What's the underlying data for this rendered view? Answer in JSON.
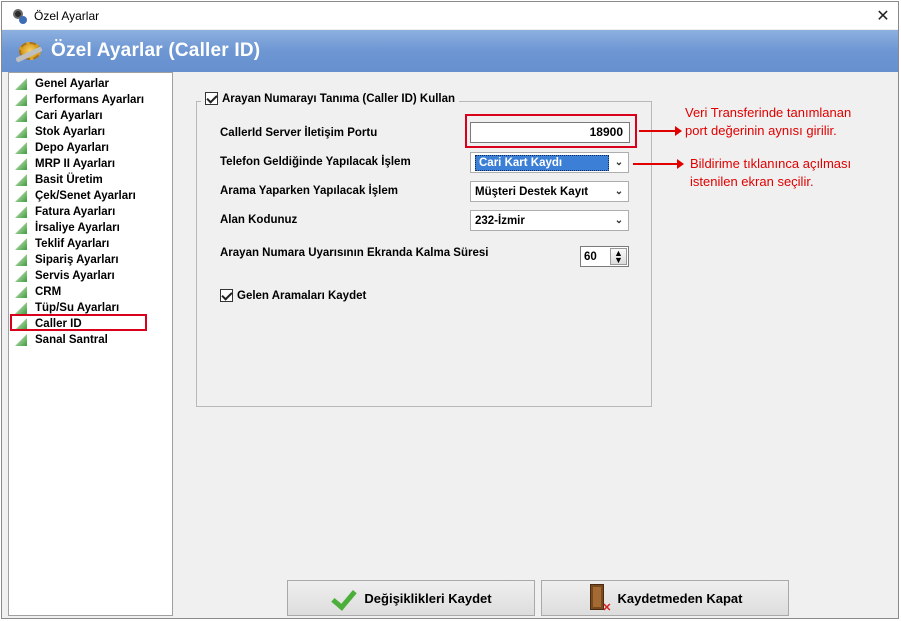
{
  "window": {
    "title": "Özel Ayarlar",
    "header_title": "Özel Ayarlar (Caller ID)"
  },
  "sidebar": {
    "items": [
      {
        "label": "Genel Ayarlar"
      },
      {
        "label": "Performans Ayarları"
      },
      {
        "label": "Cari Ayarları"
      },
      {
        "label": "Stok Ayarları"
      },
      {
        "label": "Depo Ayarları"
      },
      {
        "label": "MRP II Ayarları"
      },
      {
        "label": "Basit Üretim"
      },
      {
        "label": "Çek/Senet Ayarları"
      },
      {
        "label": "Fatura Ayarları"
      },
      {
        "label": "İrsaliye Ayarları"
      },
      {
        "label": "Teklif Ayarları"
      },
      {
        "label": "Sipariş Ayarları"
      },
      {
        "label": "Servis Ayarları"
      },
      {
        "label": "CRM"
      },
      {
        "label": "Tüp/Su Ayarları"
      },
      {
        "label": "Caller ID"
      },
      {
        "label": "Sanal Santral"
      }
    ],
    "selected": "Caller ID"
  },
  "form": {
    "group_label": "Arayan Numarayı Tanıma (Caller ID) Kullan",
    "group_checked": true,
    "port_label": "CallerId Server İletişim Portu",
    "port_value": "18900",
    "incoming_call_label": "Telefon Geldiğinde Yapılacak İşlem",
    "incoming_call_value": "Cari Kart Kaydı",
    "outgoing_call_label": "Arama Yaparken Yapılacak İşlem",
    "outgoing_call_value": "Müşteri Destek Kayıt",
    "area_code_label": "Alan Kodunuz",
    "area_code_value": "232-İzmir",
    "duration_label": "Arayan Numara Uyarısının Ekranda Kalma Süresi",
    "duration_value": "60",
    "save_calls_label": "Gelen Aramaları Kaydet",
    "save_calls_checked": true
  },
  "annotations": {
    "note1_line1": "Veri Transferinde tanımlanan",
    "note1_line2": "port değerinin aynısı girilir.",
    "note2_line1": "Bildirime tıklanınca açılması",
    "note2_line2": "istenilen ekran seçilir."
  },
  "buttons": {
    "save_label": "Değişiklikleri Kaydet",
    "close_label": "Kaydetmeden Kapat"
  },
  "colors": {
    "header_blue": "#6d96d3",
    "annotation_red": "#e00000",
    "selection_blue": "#3c7fd6"
  }
}
